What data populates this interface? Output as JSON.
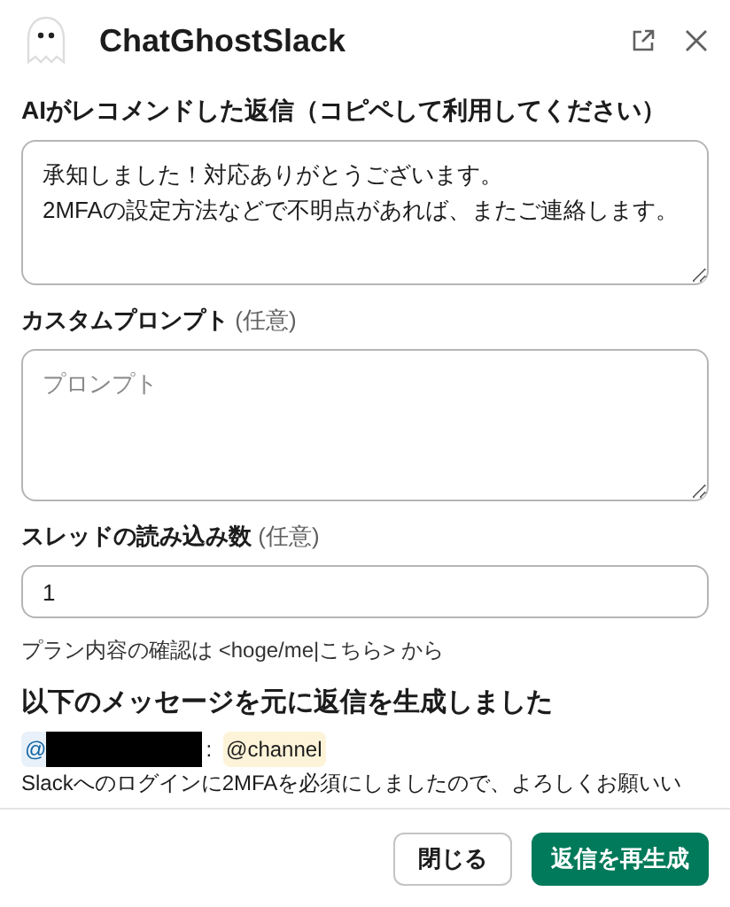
{
  "window": {
    "title": "ChatGhostSlack"
  },
  "recommended_reply": {
    "label": "AIがレコメンドした返信（コピペして利用してください）",
    "value": "承知しました！対応ありがとうございます。\n2MFAの設定方法などで不明点があれば、またご連絡します。"
  },
  "custom_prompt": {
    "label": "カスタムプロンプト",
    "optional": "(任意)",
    "placeholder": "プロンプト"
  },
  "thread_count": {
    "label": "スレッドの読み込み数",
    "optional": "(任意)",
    "value": "1"
  },
  "plan_note": "プラン内容の確認は <hoge/me|こちら> から",
  "source": {
    "heading": "以下のメッセージを元に返信を生成しました",
    "mention_prefix": "@",
    "separator": ":",
    "channel_mention": "@channel",
    "message": "Slackへのログインに2MFAを必須にしましたので、よろしくお願いい"
  },
  "buttons": [
    {
      "label": "閉じる",
      "kind": "secondary"
    },
    {
      "label": "返信を再生成",
      "kind": "primary"
    }
  ]
}
